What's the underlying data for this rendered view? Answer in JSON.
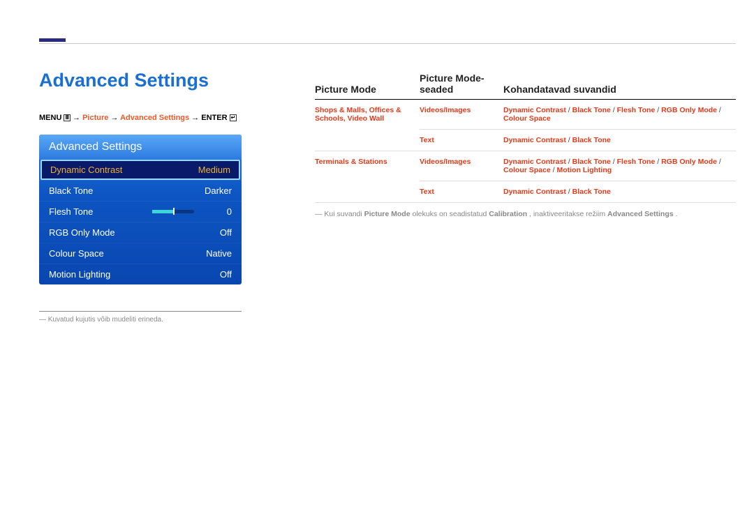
{
  "title": "Advanced Settings",
  "breadcrumb": {
    "menu": "MENU",
    "picture": "Picture",
    "adv": "Advanced Settings",
    "enter": "ENTER",
    "arrow": "→"
  },
  "osd": {
    "header": "Advanced Settings",
    "rows": [
      {
        "label": "Dynamic Contrast",
        "value": "Medium",
        "selected": true
      },
      {
        "label": "Black Tone",
        "value": "Darker"
      },
      {
        "label": "Flesh Tone",
        "value": "0",
        "slider": true
      },
      {
        "label": "RGB Only Mode",
        "value": "Off"
      },
      {
        "label": "Colour Space",
        "value": "Native"
      },
      {
        "label": "Motion Lighting",
        "value": "Off"
      }
    ]
  },
  "footnote_left": "Kuvatud kujutis võib mudeliti erineda.",
  "table": {
    "headers": [
      "Picture Mode",
      "Picture Mode-seaded",
      "Kohandatavad suvandid"
    ],
    "rows": [
      {
        "c1": "Shops & Malls, Offices & Schools, Video Wall",
        "c2": "Videos/Images",
        "c3_parts": [
          "Dynamic Contrast",
          "Black Tone",
          "Flesh Tone",
          "RGB Only Mode",
          "Colour Space"
        ]
      },
      {
        "c1": "",
        "c2": "Text",
        "c3_parts": [
          "Dynamic Contrast",
          "Black Tone"
        ]
      },
      {
        "c1": "Terminals & Stations",
        "c2": "Videos/Images",
        "c3_parts": [
          "Dynamic Contrast",
          "Black Tone",
          "Flesh Tone",
          "RGB Only Mode",
          "Colour Space",
          "Motion Lighting"
        ]
      },
      {
        "c1": "",
        "c2": "Text",
        "c3_parts": [
          "Dynamic Contrast",
          "Black Tone"
        ]
      }
    ]
  },
  "note_right": {
    "prefix": "Kui suvandi ",
    "b1": "Picture Mode",
    "mid1": " olekuks on seadistatud ",
    "b2": "Calibration",
    "mid2": ", inaktiveeritakse režiim ",
    "b3": "Advanced Settings",
    "suffix": "."
  }
}
